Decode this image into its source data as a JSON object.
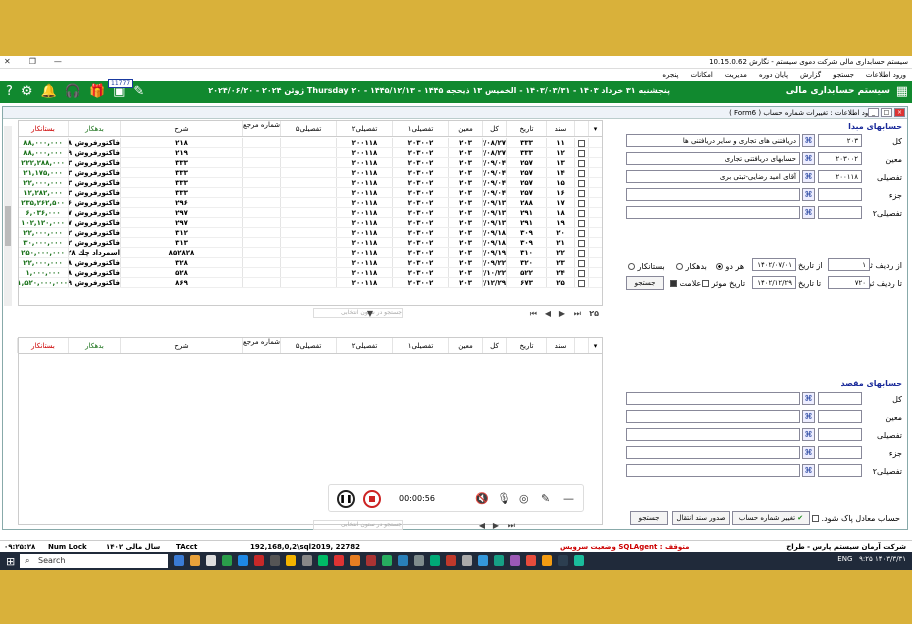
{
  "window": {
    "title": "سیستم حسابداری مالی شرکت دموی سیستم - نگارش 10.15.0.62"
  },
  "menu": [
    "ورود اطلاعات",
    "جستجو",
    "گزارش",
    "پایان دوره",
    "مدیریت",
    "امکانات",
    "پنجره"
  ],
  "topbar": {
    "app_name": "سیستم حسابداری مالی",
    "date_line": "پنجشنبه ۳۱ خرداد ۱۴۰۳ - ۱۴۰۳/۰۳/۳۱ - الخمیس ۱۳ ذیحجه ۱۴۴۵ - ۱۴۴۵/۱۲/۱۳ - Thursday ۲۰ ژوئن ۲۰۲۴ - ۲۰۲۴/۰۶/۲۰",
    "badge": "11777"
  },
  "form": {
    "title": "ورود اطلاعات : تغییرات شماره حساب ( Form6 )"
  },
  "grid": {
    "headers": [
      "سند",
      "تاریخ",
      "کل",
      "معین",
      "تفصیلی۱",
      "تفصیلی۲",
      "تفصیلی۵",
      "شماره مرجع",
      "شرح",
      "بدهکار",
      "بستانکار"
    ],
    "rows": [
      [
        "۱۱",
        "۳۳۳",
        "۱۴۰۲/۰۸/۲۷",
        "۲۰۳",
        "۲۰۳۰۰۲",
        "۲۰۰۱۱۸",
        "۲۱۸",
        "فاکتورفروش ۲۱۸ محصول - آقای ا",
        "۸۸,۰۰۰,۰۰۰"
      ],
      [
        "۱۲",
        "۳۳۳",
        "۱۴۰۲/۰۸/۲۷",
        "۲۰۳",
        "۲۰۳۰۰۲",
        "۲۰۰۱۱۸",
        "۲۱۹",
        "فاکتورفروش ۲۱۹ محصول - آقای ا",
        "۸۸,۰۰۰,۰۰۰"
      ],
      [
        "۱۳",
        "۲۵۷",
        "۱۴۰۲/۰۹/۰۴",
        "۲۰۳",
        "۲۰۳۰۰۲",
        "۲۰۰۱۱۸",
        "۳۳۳",
        "فاکتورفروش ۳۳۳ محصول - آقای ا",
        "۲۲۲,۲۸۸,۰۰۰"
      ],
      [
        "۱۴",
        "۲۵۷",
        "۱۴۰۲/۰۹/۰۴",
        "۲۰۳",
        "۲۰۳۰۰۲",
        "۲۰۰۱۱۸",
        "۳۳۳",
        "فاکتورفروش ۳۳۳ محصول - آقای ا",
        "۲۱,۱۷۵,۰۰۰"
      ],
      [
        "۱۵",
        "۲۵۷",
        "۱۴۰۲/۰۹/۰۴",
        "۲۰۳",
        "۲۰۳۰۰۲",
        "۲۰۰۱۱۸",
        "۳۳۳",
        "فاکتورفروش ۳۳۳ محصول - آقای ا",
        "۲۲,۰۰۰,۰۰۰"
      ],
      [
        "۱۶",
        "۲۵۷",
        "۱۴۰۲/۰۹/۰۴",
        "۲۰۳",
        "۲۰۳۰۰۲",
        "۲۰۰۱۱۸",
        "۳۳۳",
        "فاکتورفروش ۳۳۳ محصول - آقای ا",
        "۱۲,۲۸۲,۰۰۰"
      ],
      [
        "۱۷",
        "۲۸۸",
        "۱۴۰۲/۰۹/۱۳",
        "۲۰۳",
        "۲۰۳۰۰۲",
        "۲۰۰۱۱۸",
        "۲۹۶",
        "فاکتورفروش ۲۹۶ محصول - آقای ا",
        "۲۳۵,۲۶۲,۵۰۰"
      ],
      [
        "۱۸",
        "۲۹۱",
        "۱۴۰۲/۰۹/۱۳",
        "۲۰۳",
        "۲۰۳۰۰۲",
        "۲۰۰۱۱۸",
        "۲۹۷",
        "فاکتورفروش ۲۹۷ محصول - آقای ا",
        "۶,۰۳۶,۰۰۰"
      ],
      [
        "۱۹",
        "۲۹۱",
        "۱۴۰۲/۰۹/۱۳",
        "۲۰۳",
        "۲۰۳۰۰۲",
        "۲۰۰۱۱۸",
        "۲۹۷",
        "فاکتورفروش ۲۹۷ محصول - آقای ا",
        "۱۰۲,۱۲۰,۰۰۰"
      ],
      [
        "۲۰",
        "۳۰۹",
        "۱۴۰۲/۰۹/۱۸",
        "۲۰۳",
        "۲۰۳۰۰۲",
        "۲۰۰۱۱۸",
        "۳۱۲",
        "فاکتورفروش ۳۱۲ محصول - آقای ا",
        "۲۲,۰۰۰,۰۰۰"
      ],
      [
        "۲۱",
        "۳۰۹",
        "۱۴۰۲/۰۹/۱۸",
        "۲۰۳",
        "۲۰۳۰۰۲",
        "۲۰۰۱۱۸",
        "۳۱۳",
        "فاکتورفروش ۳۱۲ محصول - آقای ا",
        "۳۰,۰۰۰,۰۰۰"
      ],
      [
        "۲۲",
        "۳۱۰",
        "۱۴۰۲/۰۹/۱۹",
        "۲۰۳",
        "۲۰۳۰۰۲",
        "۲۰۰۱۱۸",
        "۸۵۲۸۲۸",
        "اسمرداد چك ۸۵۲۸۲۸ مورخ ۱۴۰۲/۱۲/۰۷",
        "۲۵۰,۰۰۰,۰۰۰"
      ],
      [
        "۲۳",
        "۳۲۰",
        "۱۴۰۲/۰۹/۲۲",
        "۲۰۳",
        "۲۰۳۰۰۲",
        "۲۰۰۱۱۸",
        "۳۲۸",
        "فاکتورفروش ۳۲۸ محصول - آقای ا",
        "۲۲,۰۰۰,۰۰۰"
      ],
      [
        "۲۴",
        "۵۲۲",
        "۱۴۰۲/۱۰/۲۲",
        "۲۰۳",
        "۲۰۳۰۰۲",
        "۲۰۰۱۱۸",
        "۵۲۸",
        "فاکتورفروش ۵۲۸ محصول - آقای ا",
        "۱,۰۰۰,۰۰۰"
      ],
      [
        "۲۵",
        "۶۷۳",
        "۱۴۰۲/۱۲/۲۹",
        "۲۰۳",
        "۲۰۳۰۰۲",
        "۲۰۰۱۱۸",
        "۸۶۹",
        "فاکتورفروش ۸۶۹ محصول - آقای ا",
        "۱,۵۲۰,۰۰۰,۰۰۰"
      ]
    ],
    "record_count": "۲۵",
    "search_placeholder": "جستجو در ستون انتخابی"
  },
  "source": {
    "title": "حسابهای مبدا",
    "kol_label": "کل",
    "kol_code": "۲۰۳",
    "kol_name": "دریافتنی های تجاری و سایر دریافتنی ها",
    "moin_label": "معین",
    "moin_code": "۲۰۳۰۰۲",
    "moin_name": "حسابهای دریافتنی تجاری",
    "tafsili_label": "تفصیلی",
    "tafsili_code": "۲۰۰۱۱۸",
    "tafsili_name": "آقای امید رضایی-تبتی بری",
    "joz_label": "جزء",
    "tafsili2_label": "تفصیلی۲",
    "from_row_label": "از ردیف ثبت",
    "from_row": "۱",
    "from_date_label": "از تاریخ",
    "from_date": "۱۴۰۲/۰۷/۰۱",
    "to_row_label": "تا ردیف ثبت",
    "to_row": "۷۲۰",
    "to_date_label": "تا تاریخ",
    "to_date": "۱۴۰۲/۱۲/۲۹",
    "radio_both": "هر دو",
    "radio_debit": "بدهکار",
    "radio_credit": "بستانکار",
    "effective_date": "تاریخ موثر",
    "mark": "علامت",
    "search_btn": "جستجو"
  },
  "dest": {
    "title": "حسابهای مقصد",
    "kol_label": "کل",
    "moin_label": "معین",
    "tafsili_label": "تفصیلی",
    "joz_label": "جزء",
    "tafsili2_label": "تفصیلی۲"
  },
  "bottom": {
    "remove_zero": "حساب معادل پاک شود.",
    "change_btn": "تغییر شماره حساب",
    "issue_btn": "صدور سند انتقال",
    "search_btn": "جستجو"
  },
  "recorder": {
    "time": "00:00:56"
  },
  "status": {
    "company": "شرکت آرمان سیستم پارس - طراح",
    "sqlagent": "متوقف : SQLAgent وضعیت سرویس",
    "server": "192,168,0,2\\sql2019, 22782",
    "tacct": "TAcct",
    "fiscal": "سال مالی ۱۴۰۲",
    "numlock": "Num Lock",
    "clock": "۰۹:۲۵:۲۸"
  },
  "taskbar": {
    "search": "Search",
    "lang": "ENG",
    "time": "۹:۲۵",
    "date": "۱۴۰۳/۳/۳۱"
  }
}
